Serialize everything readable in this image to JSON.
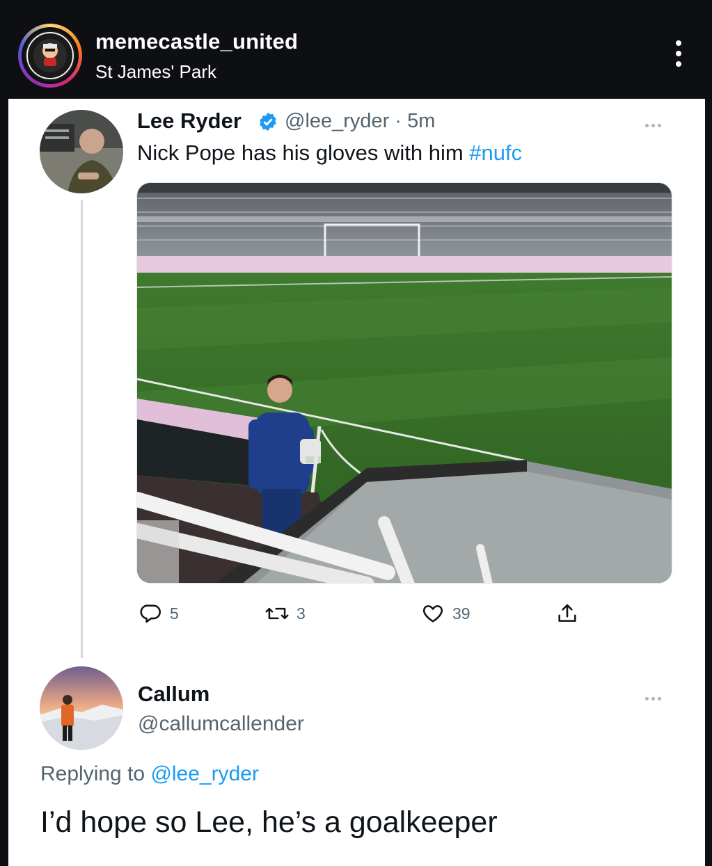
{
  "post_header": {
    "username": "memecastle_united",
    "location": "St James' Park"
  },
  "tweet": {
    "author_name": "Lee Ryder",
    "handle_time": "@lee_ryder · 5m",
    "text": "Nick Pope has his gloves with him",
    "hashtag": "#nufc",
    "replies": "5",
    "retweets": "3",
    "likes": "39"
  },
  "reply": {
    "author_name": "Callum",
    "handle": "@callumcallender",
    "replying_label": "Replying to",
    "replying_handle": "@lee_ryder",
    "text": "I’d hope so Lee, he’s a goalkeeper"
  },
  "colors": {
    "link": "#1d9bf0",
    "verified": "#1d9bf0",
    "dark_bg": "#0e0f13"
  }
}
